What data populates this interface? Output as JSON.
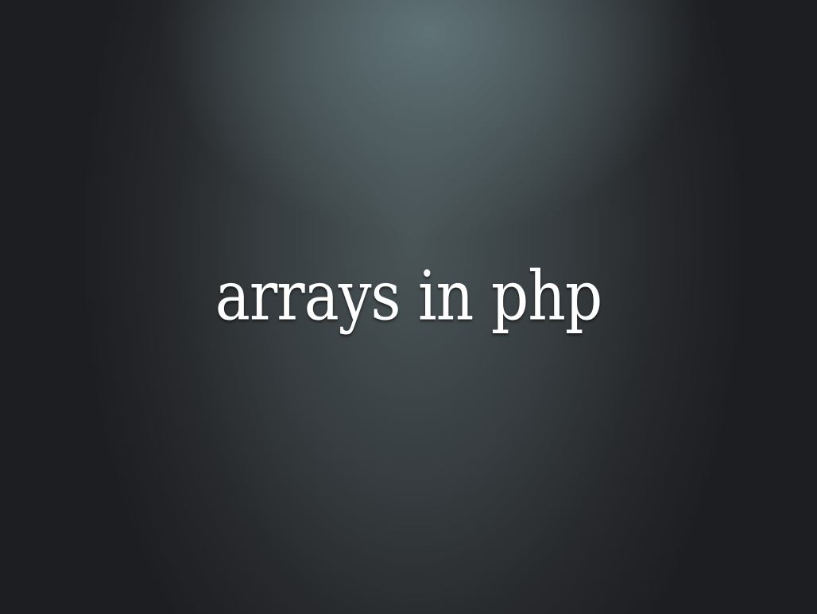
{
  "slide": {
    "title": "arrays in php"
  }
}
